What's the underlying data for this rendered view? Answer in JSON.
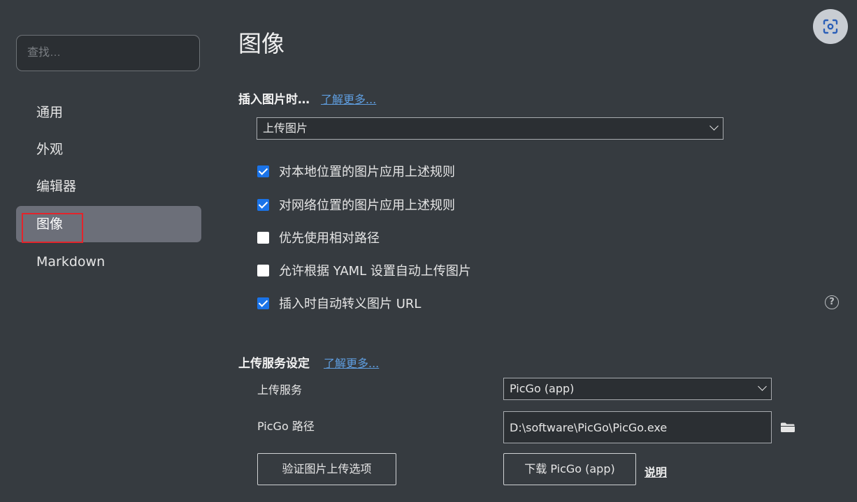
{
  "sidebar": {
    "search_placeholder": "查找…",
    "items": [
      {
        "label": "通用"
      },
      {
        "label": "外观"
      },
      {
        "label": "编辑器"
      },
      {
        "label": "图像",
        "active": true
      },
      {
        "label": "Markdown"
      }
    ]
  },
  "main": {
    "title": "图像",
    "insert_section": {
      "title": "插入图片时…",
      "learn_more": "了解更多...",
      "action_select": "上传图片",
      "checkboxes": [
        {
          "label": "对本地位置的图片应用上述规则",
          "checked": true
        },
        {
          "label": "对网络位置的图片应用上述规则",
          "checked": true
        },
        {
          "label": "优先使用相对路径",
          "checked": false
        },
        {
          "label": "允许根据 YAML 设置自动上传图片",
          "checked": false
        },
        {
          "label": "插入时自动转义图片 URL",
          "checked": true
        }
      ],
      "help_icon": "?"
    },
    "upload_section": {
      "title": "上传服务设定",
      "learn_more": "了解更多...",
      "service_label": "上传服务",
      "service_value": "PicGo (app)",
      "path_label": "PicGo 路径",
      "path_value": "D:\\software\\PicGo\\PicGo.exe",
      "verify_button": "验证图片上传选项",
      "download_button": "下载 PicGo (app)",
      "help_link": "说明"
    }
  },
  "icons": {
    "folder": "folder-icon",
    "scan": "scan-icon",
    "help": "question-circle-icon",
    "chevron": "chevron-down-icon"
  },
  "colors": {
    "background": "#363b40",
    "active_item": "#6c6f79",
    "link": "#5f9ee0",
    "checkbox_checked": "#1a73e8",
    "highlight_box": "#e3242b"
  }
}
